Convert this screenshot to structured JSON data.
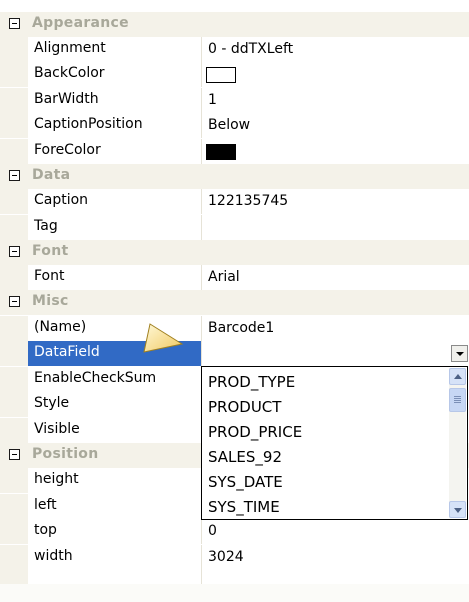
{
  "categories": {
    "appearance": "Appearance",
    "data": "Data",
    "font": "Font",
    "misc": "Misc",
    "position": "Position"
  },
  "props": {
    "alignment": {
      "name": "Alignment",
      "value": "0 - ddTXLeft"
    },
    "backcolor": {
      "name": "BackColor",
      "value": "#FFFFFF"
    },
    "barwidth": {
      "name": "BarWidth",
      "value": "1"
    },
    "captionposition": {
      "name": "CaptionPosition",
      "value": "Below"
    },
    "forecolor": {
      "name": "ForeColor",
      "value": "#000000"
    },
    "caption": {
      "name": "Caption",
      "value": "122135745"
    },
    "tag": {
      "name": "Tag",
      "value": ""
    },
    "font": {
      "name": "Font",
      "value": "Arial"
    },
    "name": {
      "name": "(Name)",
      "value": "Barcode1"
    },
    "datafield": {
      "name": "DataField",
      "value": ""
    },
    "enablechecksum": {
      "name": "EnableCheckSum",
      "value": ""
    },
    "style": {
      "name": "Style",
      "value": ""
    },
    "visible": {
      "name": "Visible",
      "value": ""
    },
    "height": {
      "name": "height",
      "value": ""
    },
    "left": {
      "name": "left",
      "value": ""
    },
    "top": {
      "name": "top",
      "value": "0"
    },
    "width": {
      "name": "width",
      "value": "3024"
    }
  },
  "dropdown": {
    "items": [
      "PROD_TYPE",
      "PRODUCT",
      "PROD_PRICE",
      "SALES_92",
      "SYS_DATE",
      "SYS_TIME"
    ]
  },
  "colors": {
    "selection": "#316ac5",
    "category_bg": "#f4f2e9",
    "category_text": "#a8a89a"
  }
}
